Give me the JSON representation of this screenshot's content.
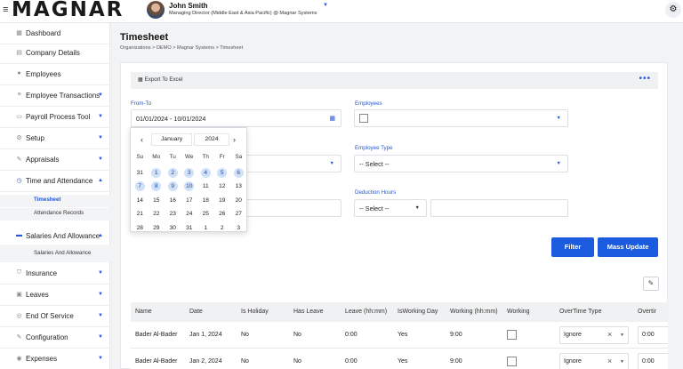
{
  "app": {
    "logo": "MAGNAR"
  },
  "user": {
    "name": "John Smith",
    "role": "Managing Director (Middle East & Asia Pacific) @ Magnar Systems"
  },
  "sidebar": {
    "items": [
      {
        "label": "Dashboard",
        "icon": "dashboard-icon",
        "glyph": "▦",
        "caret": false
      },
      {
        "label": "Company Details",
        "icon": "document-icon",
        "glyph": "▤",
        "caret": false
      },
      {
        "label": "Employees",
        "icon": "user-icon",
        "glyph": "●",
        "caret": false
      },
      {
        "label": "Employee Transactions",
        "icon": "list-icon",
        "glyph": "≡",
        "caret": true
      },
      {
        "label": "Payroll Process Tool",
        "icon": "wallet-icon",
        "glyph": "▭",
        "caret": true
      },
      {
        "label": "Setup",
        "icon": "gear-icon",
        "glyph": "⚙",
        "caret": true
      },
      {
        "label": "Appraisals",
        "icon": "tag-icon",
        "glyph": "✎",
        "caret": true
      },
      {
        "label": "Time and Attendance",
        "icon": "clock-icon",
        "glyph": "◷",
        "caret": true
      },
      {
        "label": "Salaries And Allowance",
        "icon": "money-icon",
        "glyph": "▬",
        "caret": true
      },
      {
        "label": "Insurance",
        "icon": "shield-icon",
        "glyph": "⛉",
        "caret": true
      },
      {
        "label": "Leaves",
        "icon": "briefcase-icon",
        "glyph": "▣",
        "caret": true
      },
      {
        "label": "End Of Service",
        "icon": "handshake-icon",
        "glyph": "◎",
        "caret": true
      },
      {
        "label": "Configuration",
        "icon": "edit-icon",
        "glyph": "✎",
        "caret": true
      },
      {
        "label": "Expenses",
        "icon": "receipt-icon",
        "glyph": "◉",
        "caret": true
      }
    ],
    "time_sub": [
      "Timesheet",
      "Attendance Records"
    ],
    "salaries_sub": [
      "Salaries And Allowance"
    ]
  },
  "page": {
    "title": "Timesheet",
    "breadcrumb": "Organizations  >  DEMO  >  Magnar Systems  >  Timesheet"
  },
  "toolbar": {
    "export_label": "Export To Excel",
    "more_label": "•••"
  },
  "filters": {
    "from_to_label": "From-To",
    "from_to_value": "01/01/2024 - 10/01/2024",
    "employees_label": "Employees",
    "employee_type_label": "Employee Type",
    "employee_type_value": "-- Select --",
    "deduction_hours_label": "Deduction Hours",
    "deduction_hours_value": "-- Select --"
  },
  "datepicker": {
    "month": "January",
    "year": "2024",
    "weekdays": [
      "Su",
      "Mo",
      "Tu",
      "We",
      "Th",
      "Fr",
      "Sa"
    ],
    "weeks": [
      [
        "31",
        "1",
        "2",
        "3",
        "4",
        "5",
        "6"
      ],
      [
        "7",
        "8",
        "9",
        "10",
        "11",
        "12",
        "13"
      ],
      [
        "14",
        "15",
        "16",
        "17",
        "18",
        "19",
        "20"
      ],
      [
        "21",
        "22",
        "23",
        "24",
        "25",
        "26",
        "27"
      ],
      [
        "28",
        "29",
        "30",
        "31",
        "1",
        "2",
        "3"
      ]
    ],
    "selected": [
      "1",
      "2",
      "3",
      "4",
      "5",
      "6",
      "7",
      "8",
      "9",
      "10"
    ]
  },
  "actions": {
    "filter_label": "Filter",
    "mass_update_label": "Mass Update"
  },
  "table": {
    "columns": [
      "Name",
      "Date",
      "Is Holiday",
      "Has Leave",
      "Leave (hh:mm)",
      "IsWorking Day",
      "Working (hh:mm)",
      "Working",
      "OverTime Type",
      "Overtir"
    ],
    "rows": [
      {
        "name": "Bader Al-Bader",
        "date": "Jan 1, 2024",
        "is_holiday": "No",
        "has_leave": "No",
        "leave": "0:00",
        "is_working_day": "Yes",
        "working_hours": "9:00",
        "overtime_type": "Ignore",
        "overtime": "0:00"
      },
      {
        "name": "Bader Al-Bader",
        "date": "Jan 2, 2024",
        "is_holiday": "No",
        "has_leave": "No",
        "leave": "0:00",
        "is_working_day": "Yes",
        "working_hours": "9:00",
        "overtime_type": "Ignore",
        "overtime": "0:00"
      }
    ]
  },
  "colors": {
    "accent": "#1a5be0",
    "highlight": "#cfe0f7"
  }
}
